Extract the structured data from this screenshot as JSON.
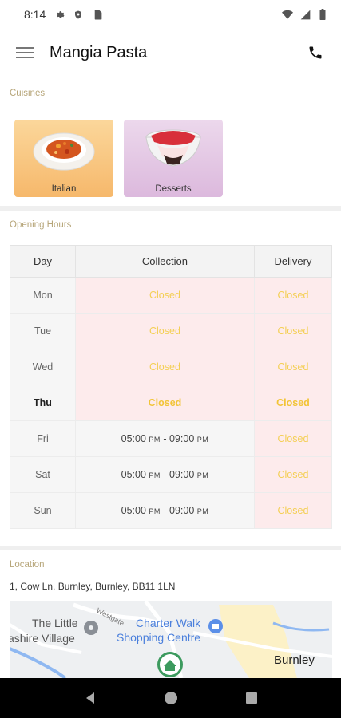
{
  "status_bar": {
    "time": "8:14"
  },
  "app_bar": {
    "title": "Mangia Pasta"
  },
  "cuisines": {
    "section_label": "Cuisines",
    "items": [
      {
        "label": "Italian"
      },
      {
        "label": "Desserts"
      }
    ]
  },
  "hours": {
    "section_label": "Opening Hours",
    "headers": [
      "Day",
      "Collection",
      "Delivery"
    ],
    "rows": [
      {
        "day": "Mon",
        "collection": "Closed",
        "delivery": "Closed"
      },
      {
        "day": "Tue",
        "collection": "Closed",
        "delivery": "Closed"
      },
      {
        "day": "Wed",
        "collection": "Closed",
        "delivery": "Closed"
      },
      {
        "day": "Thu",
        "collection": "Closed",
        "delivery": "Closed"
      },
      {
        "day": "Fri",
        "collection": {
          "start": "05:00",
          "start_ampm": "PM",
          "end": "09:00",
          "end_ampm": "PM"
        },
        "delivery": "Closed"
      },
      {
        "day": "Sat",
        "collection": {
          "start": "05:00",
          "start_ampm": "PM",
          "end": "09:00",
          "end_ampm": "PM"
        },
        "delivery": "Closed"
      },
      {
        "day": "Sun",
        "collection": {
          "start": "05:00",
          "start_ampm": "PM",
          "end": "09:00",
          "end_ampm": "PM"
        },
        "delivery": "Closed"
      }
    ]
  },
  "location": {
    "section_label": "Location",
    "address": "1, Cow Ln, Burnley, Burnley, BB11 1LN",
    "map_labels": {
      "little_village_1": "The Little",
      "little_village_2": "ashire Village",
      "charter_walk_1": "Charter Walk",
      "charter_walk_2": "Shopping Centre",
      "burnley": "Burnley",
      "westgate": "Westgate"
    }
  },
  "colors": {
    "closed_text": "#f4cf54",
    "closed_bg": "#fdebec",
    "section_label": "#b7a67a",
    "map_blue": "#8fb8f1",
    "map_green": "#3c9a5e"
  }
}
